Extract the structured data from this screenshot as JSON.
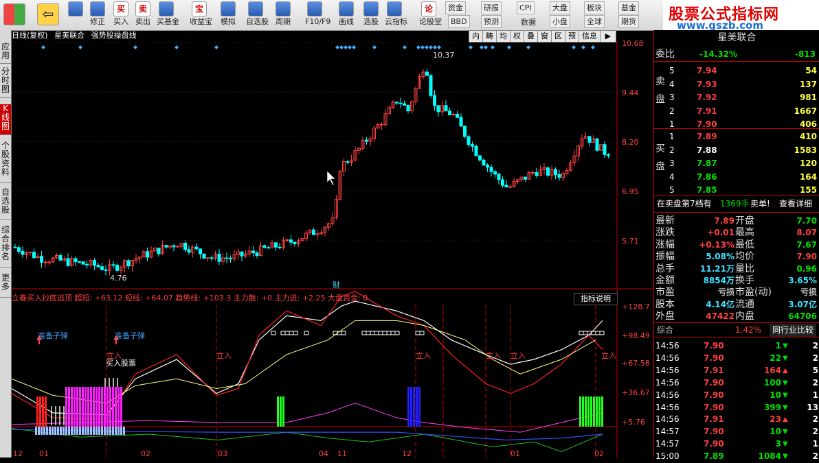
{
  "toolbar": {
    "buttons": [
      {
        "icon": "up-down-icon",
        "label": ""
      },
      {
        "icon": "refresh-icon",
        "label": "修正"
      },
      {
        "icon": "buy-icon",
        "label": "买入",
        "glyph": "买"
      },
      {
        "icon": "sell-icon",
        "label": "卖出",
        "glyph": "卖"
      },
      {
        "icon": "fund-icon",
        "label": "买基金"
      },
      {
        "icon": "treasure-icon",
        "label": "收益宝",
        "glyph": "宝"
      },
      {
        "icon": "hammer-icon",
        "label": "模拟"
      },
      {
        "icon": "star-icon",
        "label": "自选股"
      },
      {
        "icon": "clock-icon",
        "label": "周期"
      },
      {
        "icon": "f10-icon",
        "label": "F10/F9"
      },
      {
        "icon": "pen-icon",
        "label": "画线"
      },
      {
        "icon": "select-icon",
        "label": "选股"
      },
      {
        "icon": "cloud-icon",
        "label": "云指标"
      },
      {
        "icon": "forum-icon",
        "label": "论股堂",
        "glyph": "论"
      }
    ],
    "small_buttons": [
      "资金",
      "研报",
      "CPI",
      "数据",
      "BBD",
      "预测",
      "大盘",
      "板块",
      "基金",
      "小盘",
      "全球",
      "期货"
    ]
  },
  "brand": {
    "title": "股票公式指标网",
    "url": "www.gszb.com"
  },
  "left_tabs": [
    "应用",
    "分时图",
    "K线图",
    "个股资料",
    "自选股",
    "综合排名",
    "更多"
  ],
  "chart": {
    "header": [
      "日线(复权)",
      "星美联合",
      "强势股操盘线"
    ],
    "tabs": [
      "内",
      "畴",
      "均",
      "权",
      "叠",
      "窗",
      "区",
      "预",
      "信息"
    ],
    "price_labels": [
      "10.68",
      "9.44",
      "8.20",
      "6.95",
      "5.71"
    ],
    "high_label": "10.37",
    "low_label": "4.76",
    "cai_label": "财",
    "indicator_header": "立春买入抄底逃顶 超短: +63.12 短线: +64.07 趋势线: +103.3 主力散: +0 主力进: +2.25 大盘资金: 0",
    "indicator_btn": "指标说明",
    "indicator_labels": [
      "+128.7",
      "+98.49",
      "+67.58",
      "+36.67",
      "+5.76"
    ],
    "ann_ready": "准备子弹",
    "ann_enter": "立入",
    "ann_buy": "买入股票",
    "dates": [
      "12",
      "01",
      "02",
      "03",
      "04",
      "11",
      "12",
      "01",
      "02"
    ]
  },
  "quote": {
    "name": "星美联合",
    "weibi_label": "委比",
    "weibi_pct": "-14.32%",
    "weibi_val": "-813",
    "sell_label": "卖盘",
    "buy_label": "买盘",
    "sell": [
      {
        "lvl": "5",
        "price": "7.94",
        "vol": "54"
      },
      {
        "lvl": "4",
        "price": "7.93",
        "vol": "137"
      },
      {
        "lvl": "3",
        "price": "7.92",
        "vol": "981"
      },
      {
        "lvl": "2",
        "price": "7.91",
        "vol": "1667"
      },
      {
        "lvl": "1",
        "price": "7.90",
        "vol": "406"
      }
    ],
    "buy": [
      {
        "lvl": "1",
        "price": "7.89",
        "vol": "410"
      },
      {
        "lvl": "2",
        "price": "7.88",
        "vol": "1583"
      },
      {
        "lvl": "3",
        "price": "7.87",
        "vol": "120"
      },
      {
        "lvl": "4",
        "price": "7.86",
        "vol": "164"
      },
      {
        "lvl": "5",
        "price": "7.85",
        "vol": "155"
      }
    ],
    "order_note": "在卖盘第7档有",
    "order_vol": "1369手",
    "order_side": "卖单!",
    "order_btn": "查看详细",
    "stats": [
      {
        "l1": "最新",
        "v1": "7.89",
        "l2": "开盘",
        "v2": "7.70",
        "c1": "red",
        "c2": "green"
      },
      {
        "l1": "涨跌",
        "v1": "+0.01",
        "l2": "最高",
        "v2": "8.07",
        "c1": "red",
        "c2": "red"
      },
      {
        "l1": "涨幅",
        "v1": "+0.13%",
        "l2": "最低",
        "v2": "7.67",
        "c1": "red",
        "c2": "green"
      },
      {
        "l1": "振幅",
        "v1": "5.08%",
        "l2": "均价",
        "v2": "7.90",
        "c1": "cyan",
        "c2": "red"
      },
      {
        "l1": "总手",
        "v1": "11.21万",
        "l2": "量比",
        "v2": "0.96",
        "c1": "cyan",
        "c2": "green"
      },
      {
        "l1": "金额",
        "v1": "8854万",
        "l2": "换手",
        "v2": "3.65%",
        "c1": "cyan",
        "c2": "cyan"
      },
      {
        "l1": "市盈",
        "v1": "亏损",
        "l2": "市盈(动)",
        "v2": "亏损",
        "c1": "grey",
        "c2": "grey"
      },
      {
        "l1": "股本",
        "v1": "4.14亿",
        "l2": "流通",
        "v2": "3.07亿",
        "c1": "cyan",
        "c2": "cyan"
      },
      {
        "l1": "外盘",
        "v1": "47422",
        "l2": "内盘",
        "v2": "64706",
        "c1": "red",
        "c2": "green"
      }
    ],
    "compare_left": "综合",
    "compare_pct": "1.42%",
    "compare_btn": "同行业比较",
    "ticks": [
      {
        "t": "14:56",
        "p": "7.90",
        "v": "1",
        "d": "down",
        "n": "2"
      },
      {
        "t": "14:56",
        "p": "7.90",
        "v": "22",
        "d": "down",
        "n": "2"
      },
      {
        "t": "14:56",
        "p": "7.91",
        "v": "164",
        "d": "up",
        "n": "5"
      },
      {
        "t": "14:56",
        "p": "7.90",
        "v": "100",
        "d": "down",
        "n": "2"
      },
      {
        "t": "14:56",
        "p": "7.90",
        "v": "10",
        "d": "down",
        "n": "1"
      },
      {
        "t": "14:56",
        "p": "7.90",
        "v": "399",
        "d": "down",
        "n": "13"
      },
      {
        "t": "14:56",
        "p": "7.91",
        "v": "23",
        "d": "up",
        "n": "2"
      },
      {
        "t": "14:57",
        "p": "7.90",
        "v": "10",
        "d": "down",
        "n": "2"
      },
      {
        "t": "14:57",
        "p": "7.90",
        "v": "3",
        "d": "down",
        "n": "1"
      },
      {
        "t": "15:00",
        "p": "7.89",
        "v": "1084",
        "d": "down",
        "n": "2"
      }
    ]
  },
  "colors": {
    "up": "#ff4040",
    "down": "#00ffff",
    "bg": "#000000",
    "accent": "#c00000"
  }
}
